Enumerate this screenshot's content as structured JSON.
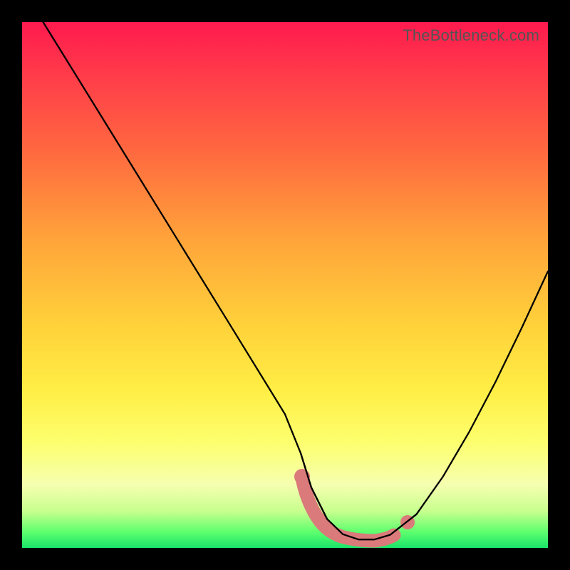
{
  "attribution": "TheBottleneck.com",
  "colors": {
    "frame": "#000000",
    "curve": "#000000",
    "blob": "#da7a7a",
    "gradient_stops": [
      "#ff1a4e",
      "#ff3b4a",
      "#ff6a3f",
      "#ffa63a",
      "#ffd23a",
      "#ffee45",
      "#fdff6e",
      "#f5ffb0",
      "#c8ff8e",
      "#5dff6e",
      "#19e36a"
    ]
  },
  "chart_data": {
    "type": "line",
    "title": "",
    "xlabel": "",
    "ylabel": "",
    "xlim": [
      0,
      100
    ],
    "ylim": [
      0,
      100
    ],
    "note": "Axes are implied (no tick labels rendered). x is horizontal position 0–100, y is vertical with 0 at bottom / 100 at top. Curve is a V-shaped bottleneck plot with a flat minimum.",
    "series": [
      {
        "name": "bottleneck-curve",
        "x": [
          4,
          10,
          20,
          30,
          40,
          50,
          53,
          55,
          58,
          61,
          64,
          67,
          70,
          75,
          80,
          85,
          90,
          95,
          100
        ],
        "y": [
          100,
          90.3,
          74.1,
          57.9,
          41.7,
          25.4,
          18,
          11.5,
          5.5,
          2.6,
          1.6,
          1.6,
          2.5,
          6.4,
          13.5,
          22,
          31.5,
          41.8,
          52.6
        ]
      }
    ],
    "markers": [
      {
        "name": "min-region-blob",
        "description": "thick salmon stroke highlighting the flat minimum of the curve, roughly x∈[53,72], y≈1.5–5, plus a small detached dot near x≈73",
        "color": "#da7a7a"
      }
    ],
    "background": {
      "type": "vertical-gradient",
      "meaning": "color encodes magnitude: red=high, green=low"
    }
  }
}
